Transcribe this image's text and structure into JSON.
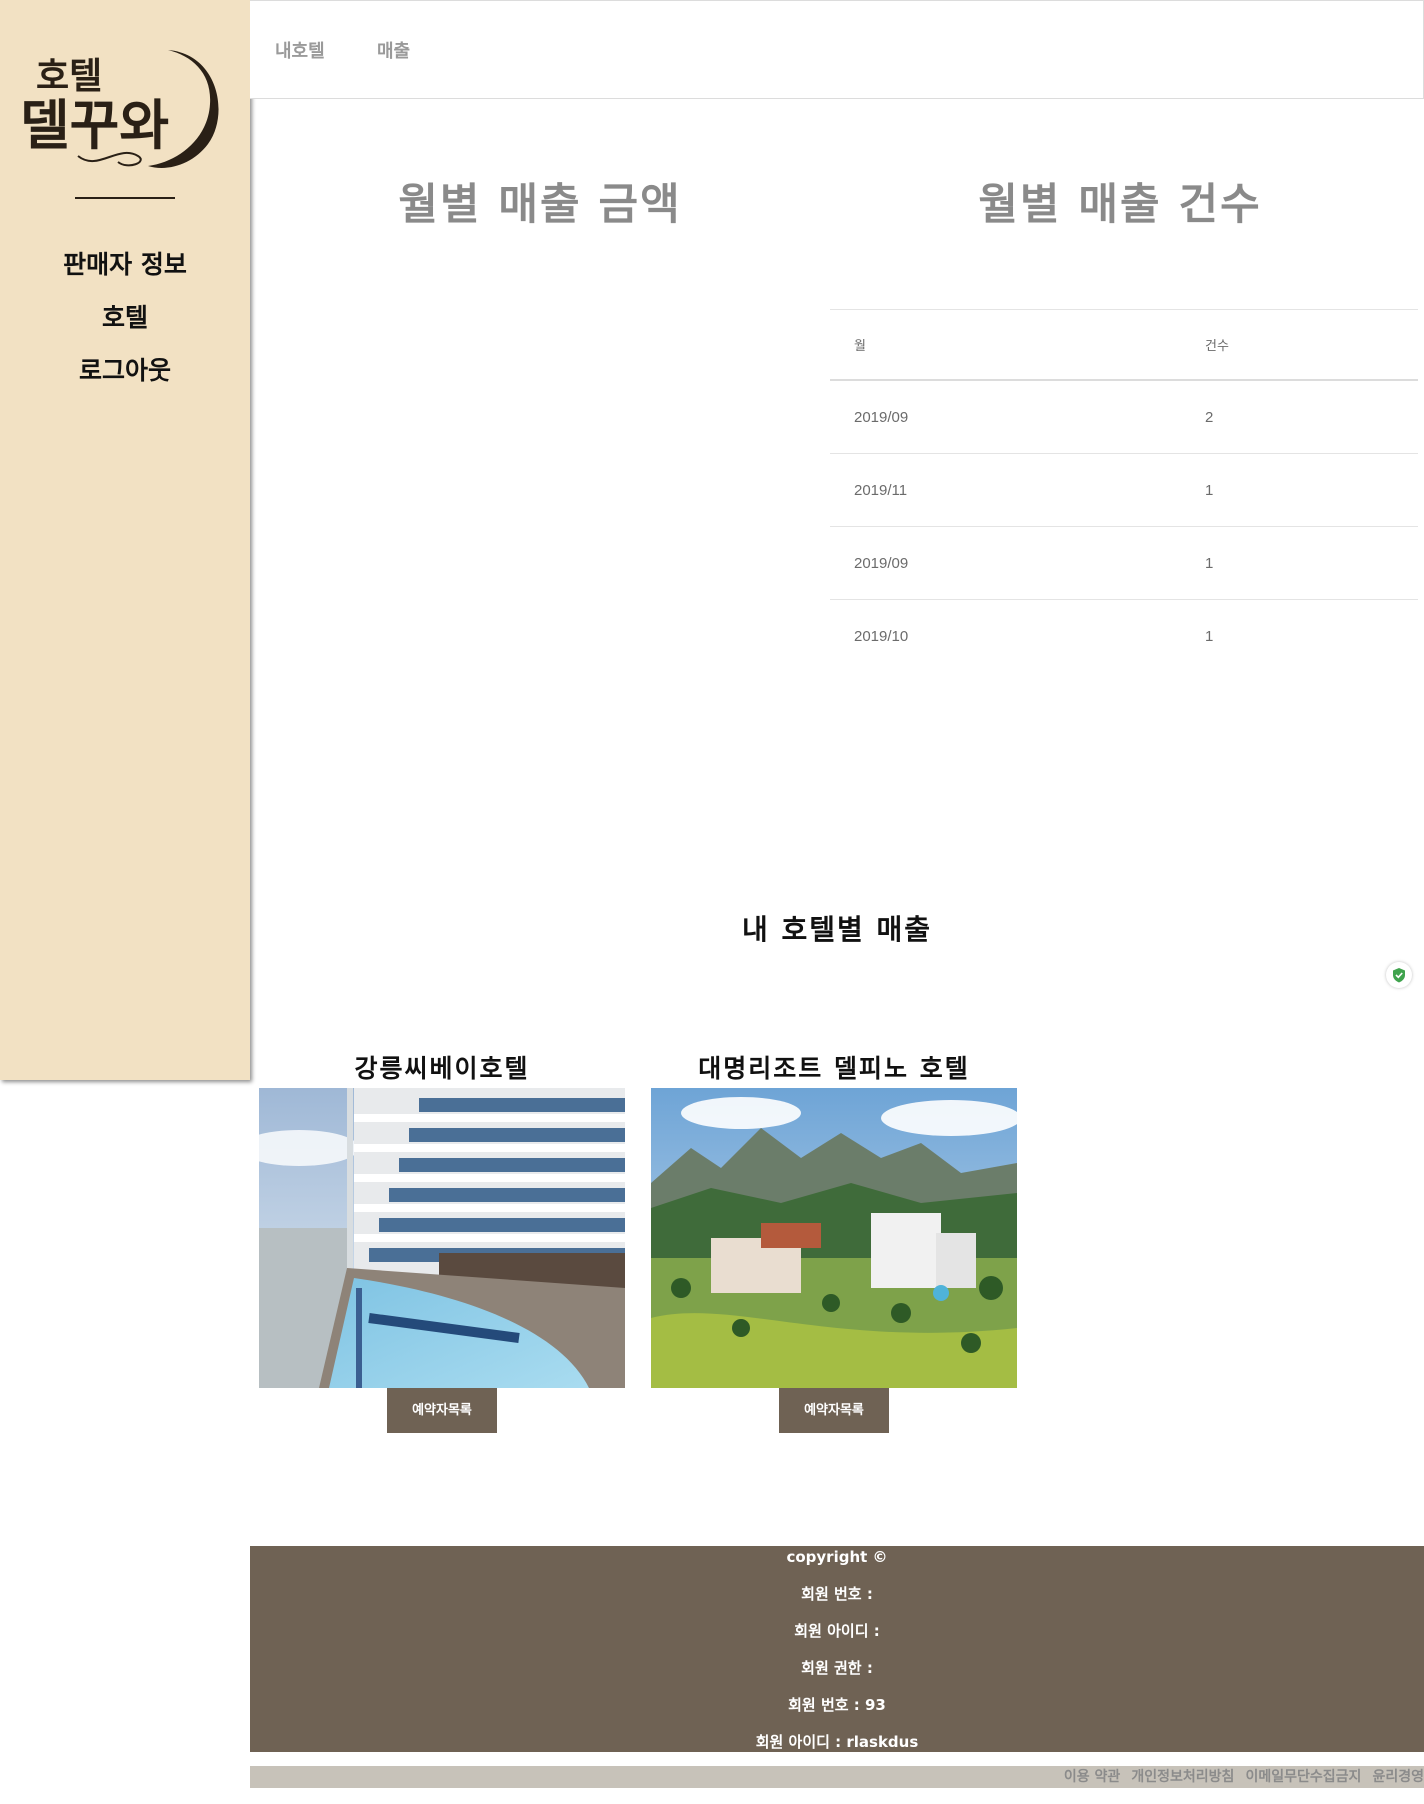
{
  "sidebar": {
    "logo_text_top": "호텔",
    "logo_text_bottom": "델꾸와",
    "items": [
      {
        "label": "판매자 정보"
      },
      {
        "label": "호텔"
      },
      {
        "label": "로그아웃"
      }
    ]
  },
  "topnav": {
    "tabs": [
      {
        "label": "내호텔"
      },
      {
        "label": "매출"
      }
    ]
  },
  "sections": {
    "amount_title": "월별 매출 금액",
    "count_title": "월별 매출 건수"
  },
  "sales_table": {
    "headers": [
      "월",
      "건수"
    ],
    "rows": [
      [
        "2019/09",
        "2"
      ],
      [
        "2019/11",
        "1"
      ],
      [
        "2019/09",
        "1"
      ],
      [
        "2019/10",
        "1"
      ]
    ]
  },
  "hotel_section": {
    "title": "내 호텔별 매출",
    "hotels": [
      {
        "name": "강릉씨베이호텔",
        "button": "예약자목록"
      },
      {
        "name": "대명리조트 델피노 호텔",
        "button": "예약자목록"
      }
    ]
  },
  "footer": {
    "lines": [
      "copyright ©",
      "회원 번호 :",
      "회원 아이디 :",
      "회원 권한 :",
      "회원 번호 : 93",
      "회원 아이디 : rlaskdus"
    ],
    "links": [
      "이용 약관",
      "개인정보처리방침",
      "이메일무단수집금지",
      "윤리경영"
    ]
  },
  "colors": {
    "sidebar_bg": "#f2e1c3",
    "footer_bg": "#6f6254",
    "button_bg": "#6f6254",
    "bottom_bar_bg": "#c7c2b9"
  }
}
